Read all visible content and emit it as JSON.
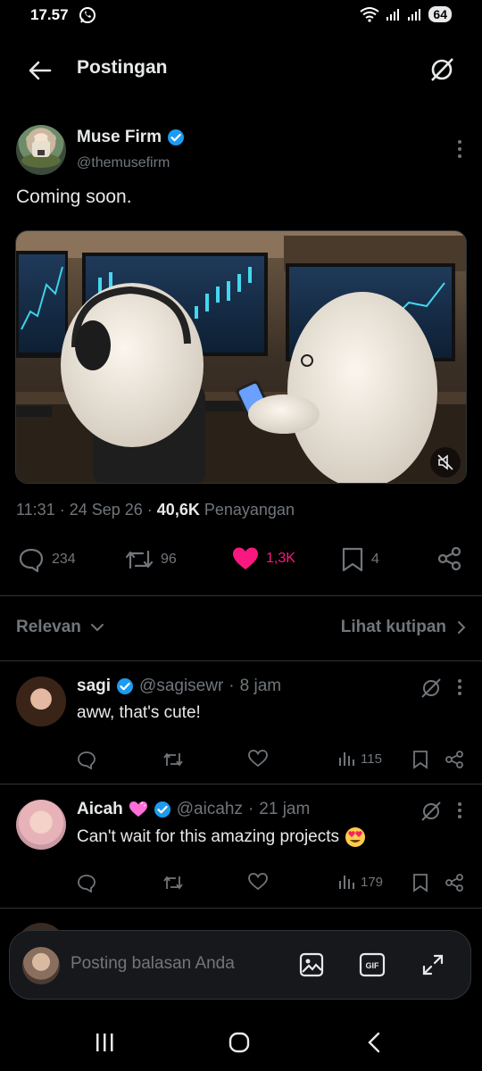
{
  "status_bar": {
    "time": "17.57",
    "battery": "64"
  },
  "header": {
    "title": "Postingan"
  },
  "post": {
    "author_name": "Muse Firm",
    "author_handle": "@themusefirm",
    "text": "Coming soon.",
    "time": "11:31",
    "date": "24 Sep 26",
    "views": "40,6K",
    "views_label": "Penayangan",
    "replies": "234",
    "reposts": "96",
    "likes": "1,3K",
    "bookmarks": "4"
  },
  "sort": {
    "label": "Relevan",
    "quotes_link": "Lihat kutipan"
  },
  "replies": [
    {
      "name": "sagi",
      "handle": "@sagisewr",
      "time": "8 jam",
      "text": "aww, that's cute!",
      "views": "115"
    },
    {
      "name": "Aicah",
      "handle": "@aicahz",
      "time": "21 jam",
      "text": "Can't wait for this amazing projects",
      "views": "179"
    }
  ],
  "compose": {
    "placeholder": "Posting balasan Anda"
  },
  "colors": {
    "accent_blue": "#1d9bf0",
    "like_pink": "#f91880",
    "muted": "#71767b",
    "divider": "#2f3336"
  }
}
